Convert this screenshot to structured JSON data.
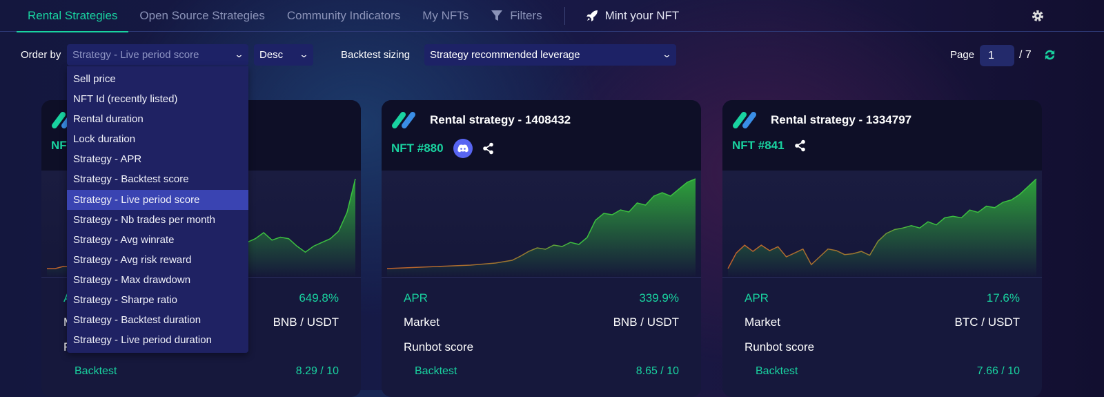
{
  "nav": {
    "tabs": [
      {
        "label": "Rental Strategies",
        "active": true
      },
      {
        "label": "Open Source Strategies"
      },
      {
        "label": "Community Indicators"
      },
      {
        "label": "My NFTs"
      },
      {
        "label": "Filters",
        "icon": "filter-icon"
      }
    ],
    "mint": "Mint your NFT"
  },
  "toolbar": {
    "order_by_label": "Order by",
    "order_by_value": "Strategy - Live period score",
    "direction": "Desc",
    "backtest_label": "Backtest sizing",
    "backtest_value": "Strategy recommended leverage",
    "page_label": "Page",
    "page_value": "1",
    "page_total": "/ 7"
  },
  "dropdown": {
    "options": [
      "Sell price",
      "NFT Id (recently listed)",
      "Rental duration",
      "Lock duration",
      "Strategy - APR",
      "Strategy - Backtest score",
      "Strategy - Live period score",
      "Strategy - Nb trades per month",
      "Strategy - Avg winrate",
      "Strategy - Avg risk reward",
      "Strategy - Max drawdown",
      "Strategy - Sharpe ratio",
      "Strategy - Backtest duration",
      "Strategy - Live period duration"
    ],
    "selected": 6
  },
  "colors": {
    "accent": "#19d3a0",
    "dropdown_bg": "#1f2263",
    "selected_bg": "#3a44b2"
  },
  "cards": [
    {
      "title": "",
      "nft": "NFT",
      "discord": false,
      "apr_label": "APR",
      "apr": "649.8%",
      "market_label": "Market",
      "market": "BNB / USDT",
      "score_label": "Runbot score",
      "backtest_label": "Backtest",
      "backtest": "8.29 / 10",
      "equity": [
        2,
        2,
        2.3,
        2.2,
        2.4,
        2.3,
        2.6,
        2.5,
        3,
        3.5,
        4.5,
        5,
        5.5,
        6,
        6.5,
        7,
        8.5,
        9,
        8,
        7.5,
        8,
        6.5,
        7,
        6,
        5.5,
        6,
        6.8,
        5.8,
        6.2,
        6,
        5,
        4.2,
        5,
        5.5,
        6,
        7,
        9.5,
        14
      ]
    },
    {
      "title": "Rental strategy - 1408432",
      "nft": "NFT #880",
      "discord": true,
      "apr_label": "APR",
      "apr": "339.9%",
      "market_label": "Market",
      "market": "BNB / USDT",
      "score_label": "Runbot score",
      "backtest_label": "Backtest",
      "backtest": "8.65 / 10",
      "equity": [
        0,
        0.05,
        0.1,
        0.15,
        0.2,
        0.25,
        0.3,
        0.35,
        0.4,
        0.45,
        0.5,
        0.6,
        0.7,
        0.8,
        1,
        1.2,
        1.8,
        2.5,
        3,
        2.8,
        3.4,
        3.2,
        3.8,
        3.5,
        4.5,
        7,
        8,
        7.8,
        8.5,
        8.2,
        9.5,
        9.2,
        10.5,
        11,
        10.5,
        11.5,
        12.5,
        13
      ]
    },
    {
      "title": "Rental strategy - 1334797",
      "nft": "NFT #841",
      "discord": false,
      "apr_label": "APR",
      "apr": "17.6%",
      "market_label": "Market",
      "market": "BTC / USDT",
      "score_label": "Runbot score",
      "backtest_label": "Backtest",
      "backtest": "7.66 / 10",
      "equity": [
        2,
        4,
        5,
        4.2,
        5,
        4.3,
        4.8,
        3.5,
        4,
        4.5,
        2.5,
        3.5,
        4.5,
        4.3,
        3.8,
        3.9,
        4.2,
        3.7,
        5.5,
        6.5,
        7,
        7.2,
        7.5,
        7.2,
        8,
        7.6,
        8.5,
        8.7,
        8.5,
        9.5,
        9.2,
        10,
        9.8,
        10.5,
        10.8,
        11.5,
        12.5,
        13.5
      ]
    }
  ]
}
